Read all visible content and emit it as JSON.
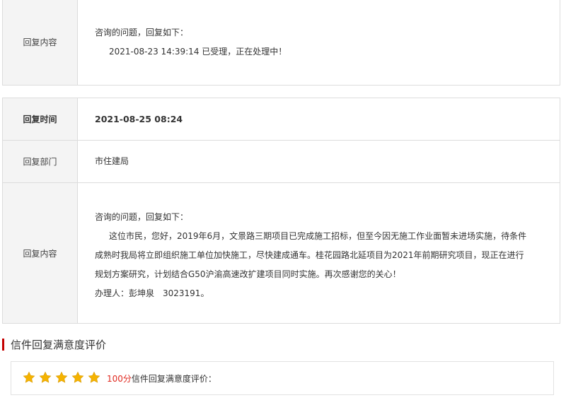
{
  "first_block": {
    "label": "回复内容",
    "lines": [
      "咨询的问题，回复如下：",
      "2021-08-23 14:39:14 已受理，正在处理中！"
    ]
  },
  "second_block": {
    "time_label": "回复时间",
    "time_value": "2021-08-25 08:24",
    "dept_label": "回复部门",
    "dept_value": "市住建局",
    "content_label": "回复内容",
    "content_intro": "咨询的问题，回复如下：",
    "content_lines": [
      "这位市民，您好，2019年6月，文景路三期项目已完成施工招标，但至今因无施工作业面暂未进场实施，待条件",
      "成熟时我局将立即组织施工单位加快施工，尽快建成通车。桂花园路北延项目为2021年前期研究项目，现正在进行",
      "规划方案研究，计划结合G50沪渝高速改扩建项目同时实施。再次感谢您的关心！"
    ],
    "handler": "办理人：彭坤泉　3023191。"
  },
  "satisfaction": {
    "title": "信件回复满意度评价",
    "stars": 5,
    "score": "100分",
    "label": "信件回复满意度评价：",
    "star_color": "#f5b301",
    "accent_color": "#c40000"
  }
}
